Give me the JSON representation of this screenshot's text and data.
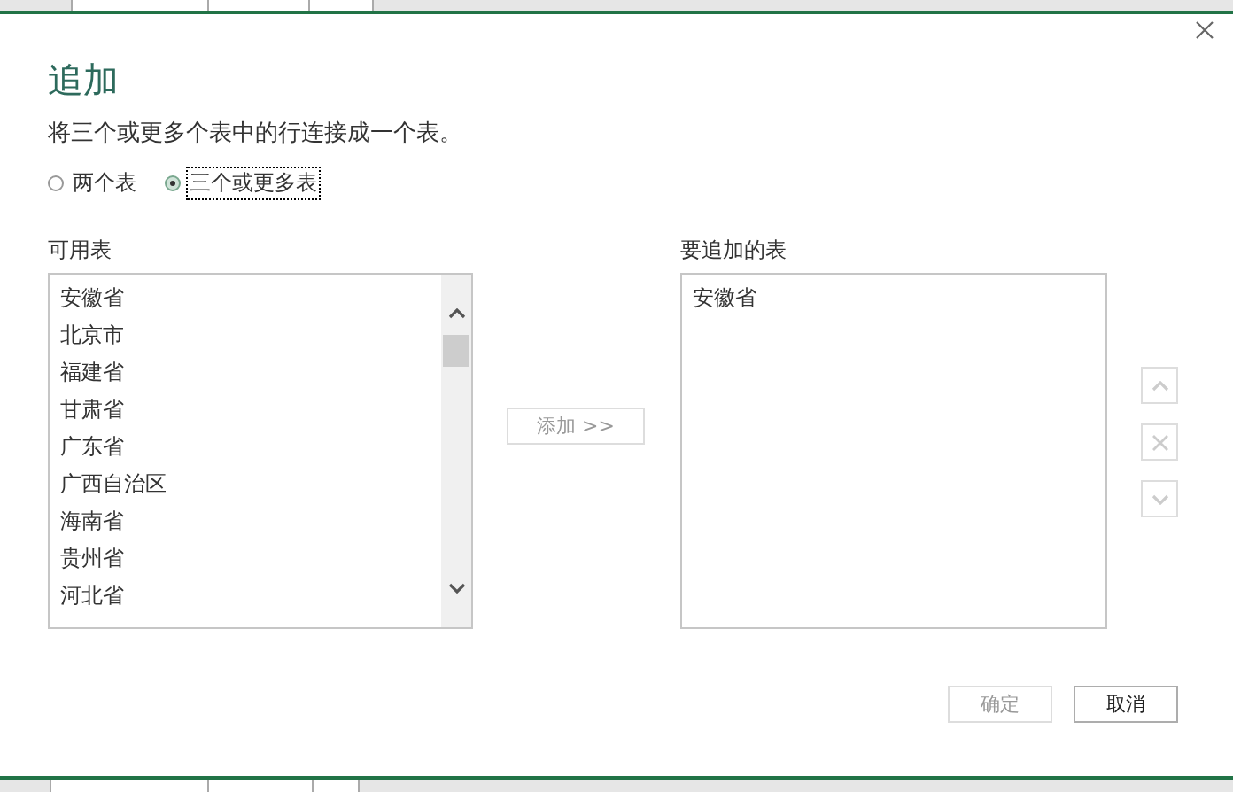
{
  "dialog": {
    "title": "追加",
    "description": "将三个或更多个表中的行连接成一个表。",
    "modes": [
      {
        "label": "两个表",
        "selected": false,
        "focused": false
      },
      {
        "label": "三个或更多表",
        "selected": true,
        "focused": true
      }
    ],
    "available": {
      "label": "可用表",
      "items": [
        "安徽省",
        "北京市",
        "福建省",
        "甘肃省",
        "广东省",
        "广西自治区",
        "海南省",
        "贵州省",
        "河北省"
      ]
    },
    "add_button": {
      "label": "添加 >>",
      "disabled": true
    },
    "appended": {
      "label": "要追加的表",
      "items": [
        "安徽省"
      ]
    },
    "order_buttons": [
      {
        "kind": "up",
        "disabled": true
      },
      {
        "kind": "remove",
        "disabled": true
      },
      {
        "kind": "down",
        "disabled": true
      }
    ],
    "buttons": [
      {
        "label": "确定",
        "disabled": true
      },
      {
        "label": "取消",
        "disabled": false
      }
    ]
  }
}
